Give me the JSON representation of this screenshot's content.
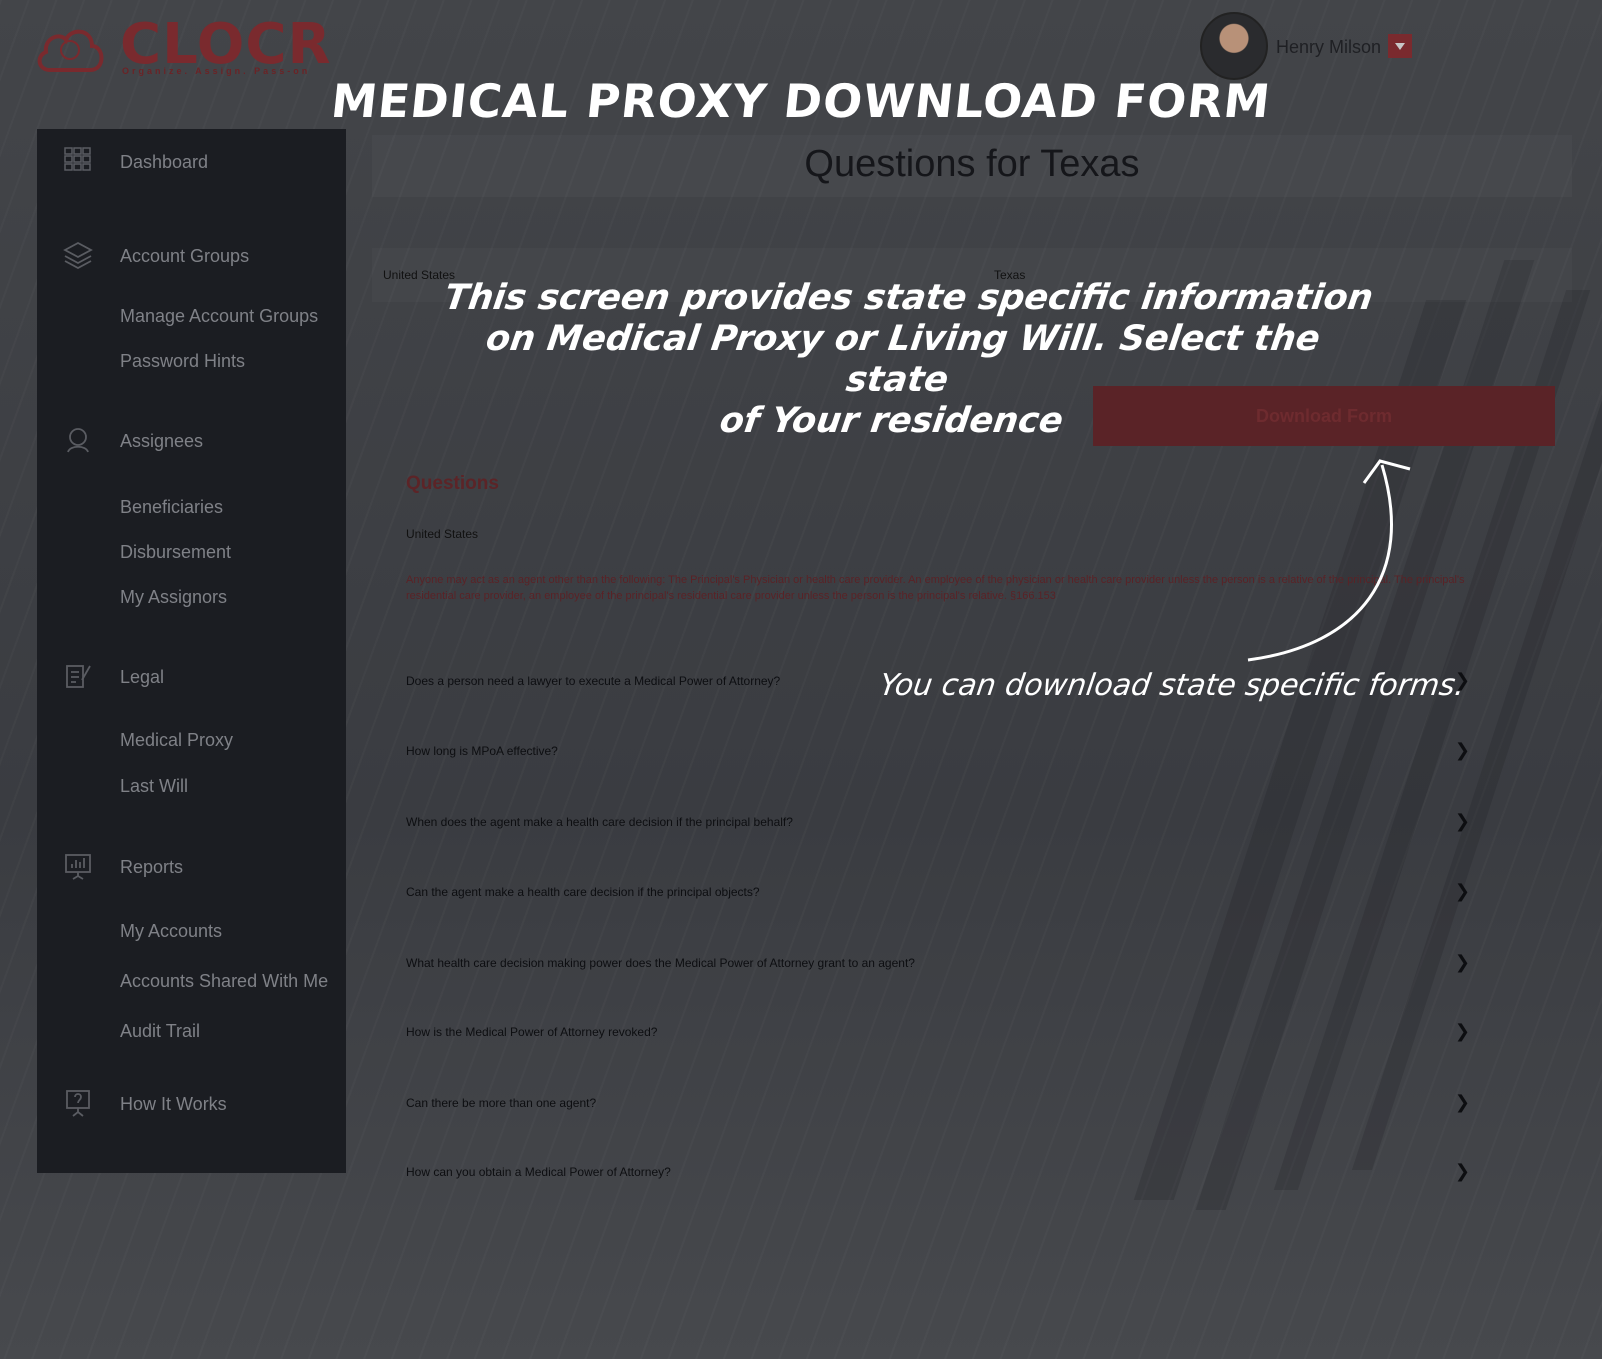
{
  "banner_title": "MEDICAL PROXY DOWNLOAD FORM",
  "brand": {
    "name": "CLOCR",
    "tagline": "Organize. Assign. Pass-on",
    "color": "#7a2a2e"
  },
  "user": {
    "name": "Henry Milson"
  },
  "sidebar": {
    "dashboard": "Dashboard",
    "account_groups": "Account Groups",
    "manage_account_groups": "Manage Account Groups",
    "password_hints": "Password Hints",
    "assignees": "Assignees",
    "beneficiaries": "Beneficiaries",
    "disbursement": "Disbursement",
    "my_assignors": "My Assignors",
    "legal": "Legal",
    "medical_proxy": "Medical Proxy",
    "last_will": "Last Will",
    "reports": "Reports",
    "my_accounts": "My Accounts",
    "accounts_shared": "Accounts Shared With Me",
    "audit_trail": "Audit Trail",
    "how_it_works": "How It Works"
  },
  "main": {
    "page_title": "Questions for Texas",
    "country": "United States",
    "state": "Texas",
    "download_label": "Download Form",
    "questions_heading": "Questions",
    "questions_country": "United States",
    "note": "Anyone may act as an agent other than the following: The Principal's Physician or health care provider. An employee of the physician or health care provider unless the person is a relative of the principal. The principal's residential care provider, an employee of the principal's residential care provider unless the person is the principal's relative. §166.153",
    "faqs": [
      "Does a person need a lawyer to execute a Medical Power of Attorney?",
      "How long is MPoA effective?",
      "When does the agent make a health care decision if the principal behalf?",
      "Can the agent make a health care decision if the principal objects?",
      "What health care decision making power does the Medical Power of Attorney grant to an agent?",
      "How is the Medical Power of Attorney revoked?",
      "Can there be more than one agent?",
      "How can you obtain a Medical Power of Attorney?"
    ]
  },
  "annotations": {
    "main_line1": "This screen provides state specific information",
    "main_line2": "on Medical Proxy or Living Will. Select the state",
    "main_line3": "of Your residence",
    "download_note": "You can download state specific forms."
  }
}
